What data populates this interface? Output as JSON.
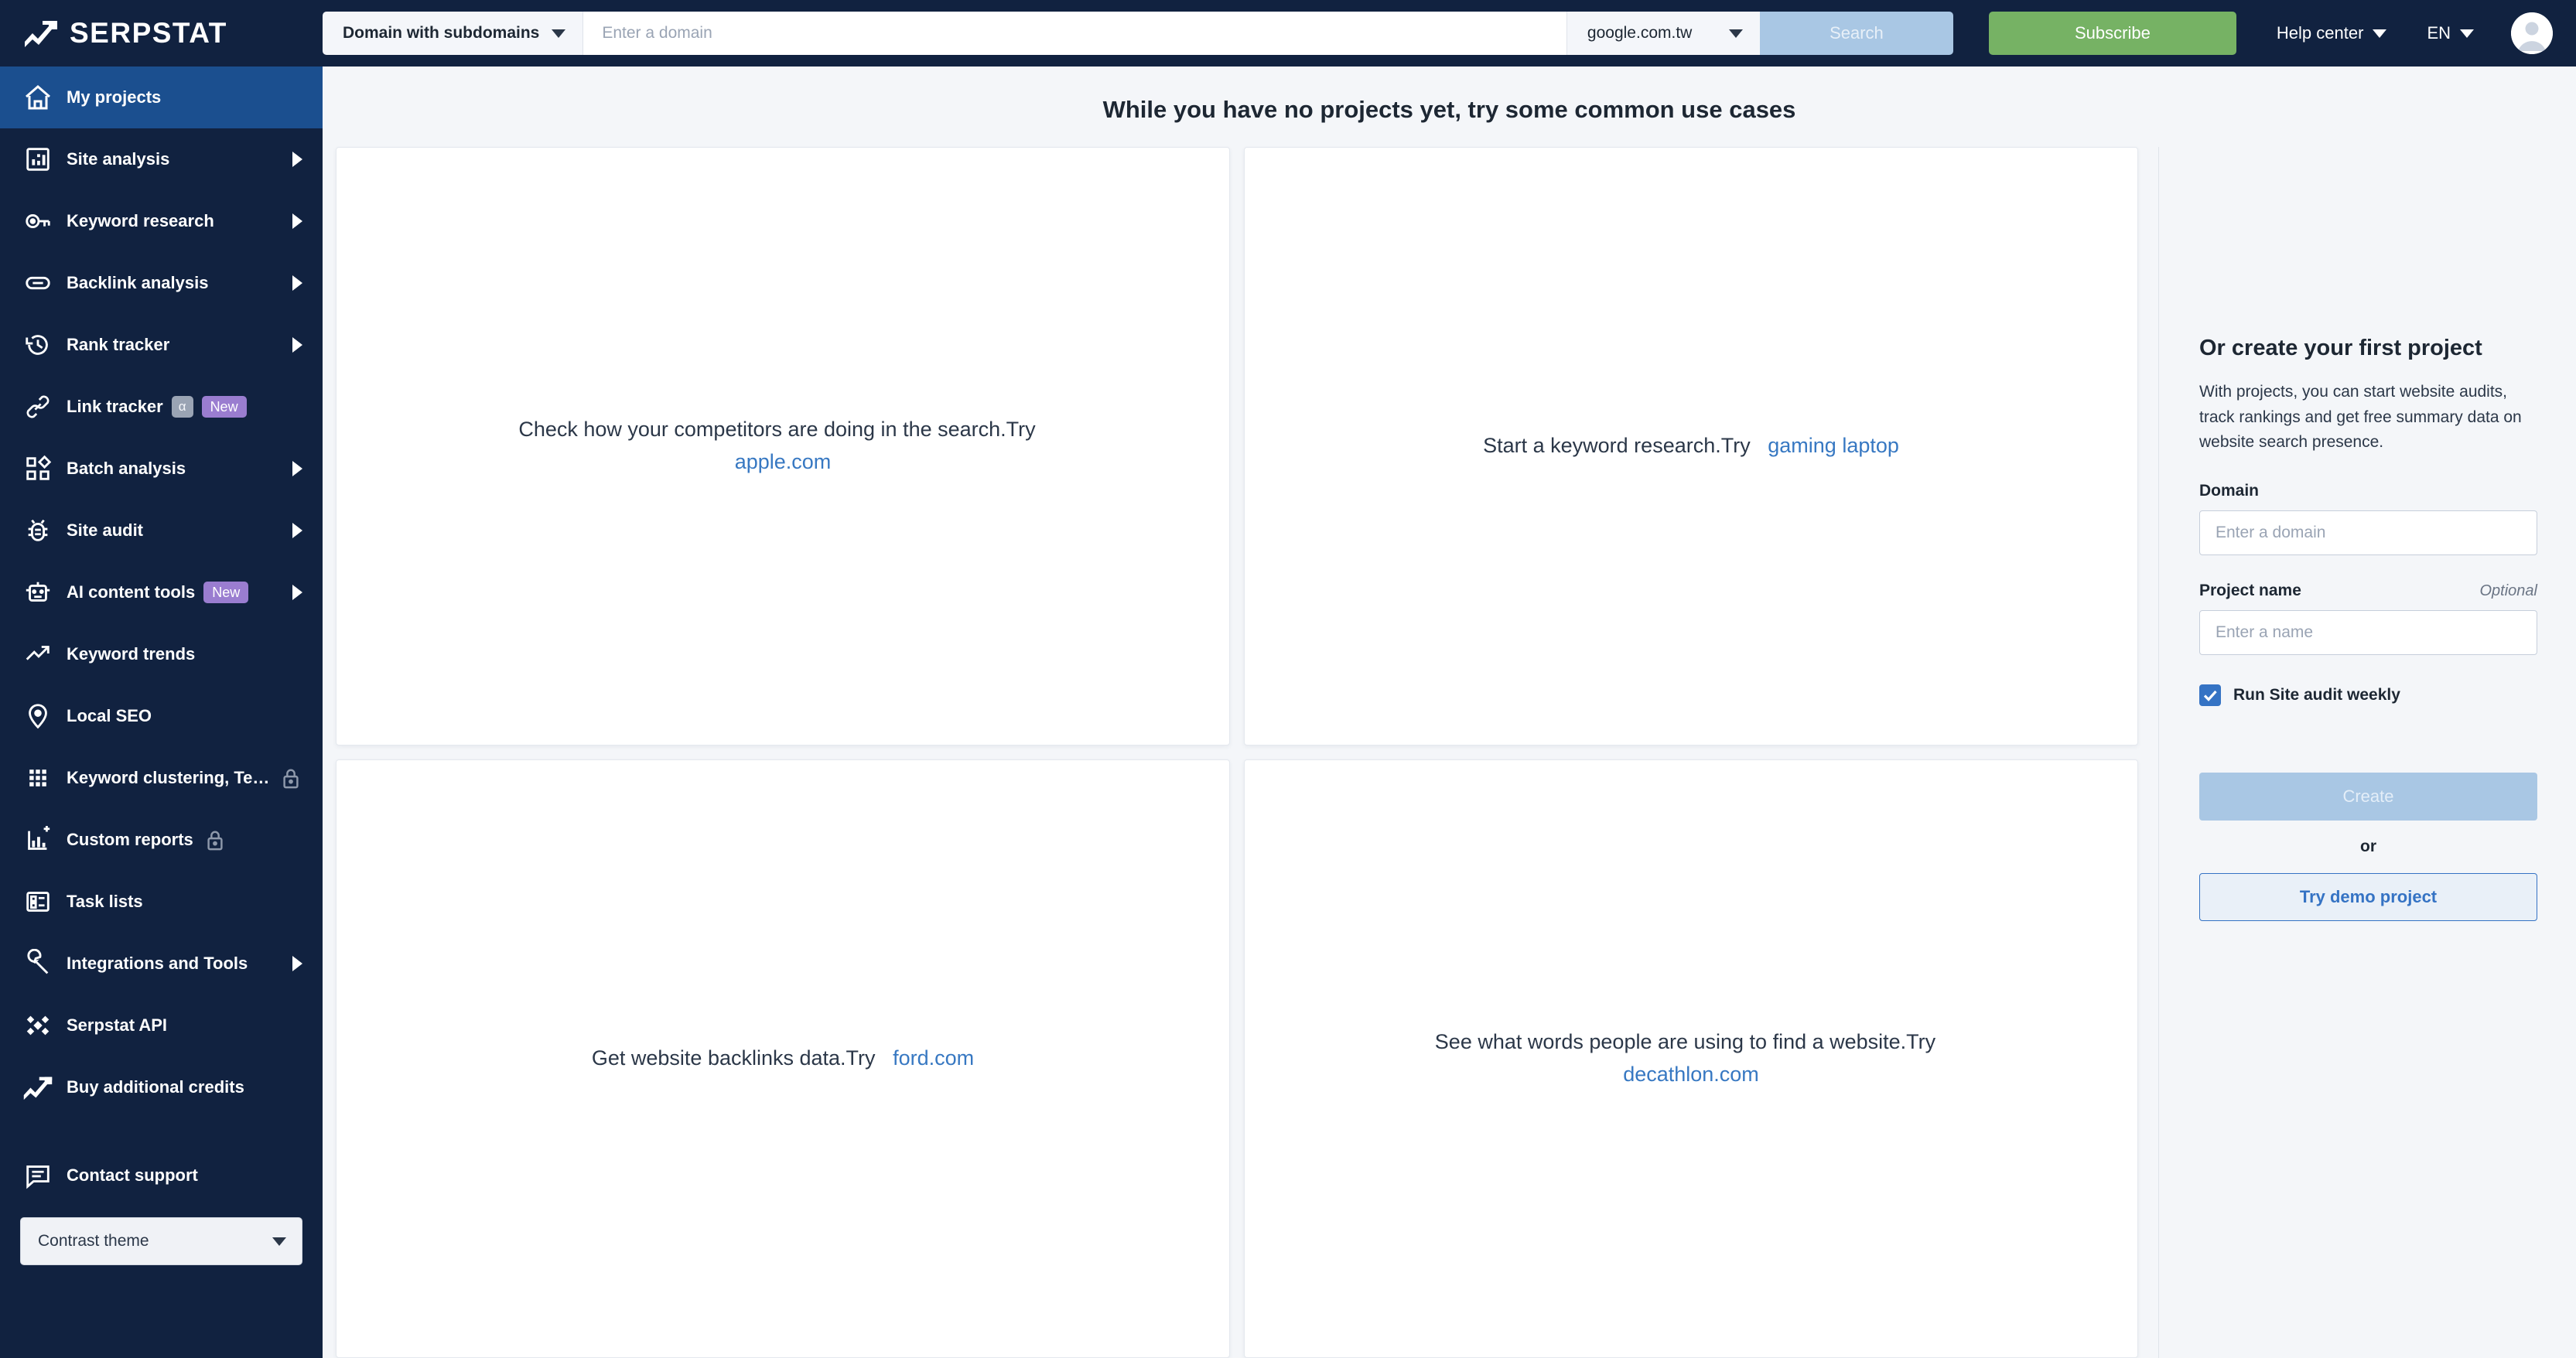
{
  "brand": {
    "name": "SERPSTAT",
    "logo_icon": "serpstat-arrow-logo"
  },
  "topbar": {
    "mode_select": {
      "label": "Domain with subdomains",
      "icon": "chevron-down-icon"
    },
    "domain_input": {
      "value": "",
      "placeholder": "Enter a domain"
    },
    "database_select": {
      "label": "google.com.tw",
      "icon": "chevron-down-icon"
    },
    "search_button": "Search",
    "subscribe_button": "Subscribe",
    "help_center": {
      "label": "Help center",
      "icon": "chevron-down-icon"
    },
    "language": {
      "label": "EN",
      "icon": "chevron-down-icon"
    },
    "avatar": "user-avatar"
  },
  "sidebar": {
    "items": [
      {
        "label": "My projects",
        "icon": "home-icon",
        "active": true,
        "arrow": false,
        "badges": [],
        "lock": false
      },
      {
        "label": "Site analysis",
        "icon": "bar-chart-box-icon",
        "active": false,
        "arrow": true,
        "badges": [],
        "lock": false
      },
      {
        "label": "Keyword research",
        "icon": "key-icon",
        "active": false,
        "arrow": true,
        "badges": [],
        "lock": false
      },
      {
        "label": "Backlink analysis",
        "icon": "link-chain-icon",
        "active": false,
        "arrow": true,
        "badges": [],
        "lock": false
      },
      {
        "label": "Rank tracker",
        "icon": "clock-rewind-icon",
        "active": false,
        "arrow": true,
        "badges": [],
        "lock": false
      },
      {
        "label": "Link tracker",
        "icon": "link-icon",
        "active": false,
        "arrow": false,
        "badges": [
          "α",
          "New"
        ],
        "lock": false
      },
      {
        "label": "Batch analysis",
        "icon": "grid-shapes-icon",
        "active": false,
        "arrow": true,
        "badges": [],
        "lock": false
      },
      {
        "label": "Site audit",
        "icon": "bug-icon",
        "active": false,
        "arrow": true,
        "badges": [],
        "lock": false
      },
      {
        "label": "AI content tools",
        "icon": "robot-icon",
        "active": false,
        "arrow": true,
        "badges": [
          "New"
        ],
        "lock": false
      },
      {
        "label": "Keyword trends",
        "icon": "trend-up-icon",
        "active": false,
        "arrow": false,
        "badges": [],
        "lock": false
      },
      {
        "label": "Local SEO",
        "icon": "map-pin-icon",
        "active": false,
        "arrow": false,
        "badges": [],
        "lock": false
      },
      {
        "label": "Keyword clustering, Te…",
        "icon": "dots-grid-icon",
        "active": false,
        "arrow": false,
        "badges": [],
        "lock": true
      },
      {
        "label": "Custom reports",
        "icon": "chart-plus-icon",
        "active": false,
        "arrow": false,
        "badges": [],
        "lock": true
      },
      {
        "label": "Task lists",
        "icon": "list-box-icon",
        "active": false,
        "arrow": false,
        "badges": [],
        "lock": false
      },
      {
        "label": "Integrations and Tools",
        "icon": "wrench-icon",
        "active": false,
        "arrow": true,
        "badges": [],
        "lock": false
      },
      {
        "label": "Serpstat API",
        "icon": "diamond-cluster-icon",
        "active": false,
        "arrow": false,
        "badges": [],
        "lock": false
      },
      {
        "label": "Buy additional credits",
        "icon": "serpstat-arrow-logo",
        "active": false,
        "arrow": false,
        "badges": [],
        "lock": false
      }
    ],
    "contact_support": {
      "label": "Contact support",
      "icon": "chat-box-icon"
    },
    "theme_select": {
      "label": "Contrast theme",
      "icon": "chevron-down-icon"
    }
  },
  "main": {
    "title": "While you have no projects yet, try some common use cases",
    "cards": [
      {
        "text": "Check how your competitors are doing in the search.Try",
        "link": "apple.com"
      },
      {
        "text": "Start a keyword research.Try",
        "link": "gaming laptop"
      },
      {
        "text": "Get website backlinks data.Try",
        "link": "ford.com"
      },
      {
        "text": "See what words people are using to find a website.Try",
        "link": "decathlon.com"
      }
    ]
  },
  "right_panel": {
    "title": "Or create your first project",
    "description": "With projects, you can start website audits, track rankings and get free summary data on website search presence.",
    "domain_label": "Domain",
    "domain_placeholder": "Enter a domain",
    "domain_value": "",
    "project_name_label": "Project name",
    "project_name_optional": "Optional",
    "project_name_placeholder": "Enter a name",
    "project_name_value": "",
    "checkbox_label": "Run Site audit weekly",
    "checkbox_checked": true,
    "create_button": "Create",
    "or_text": "or",
    "demo_button": "Try demo project"
  },
  "colors": {
    "sidebar_bg": "#112240",
    "sidebar_active": "#1b4f8f",
    "accent_blue": "#3573c4",
    "link_blue": "#3778c2",
    "subscribe_green": "#76b264",
    "disabled_blue": "#a9c7e4",
    "badge_purple": "#9a7dd0",
    "page_bg": "#f4f6f9"
  }
}
